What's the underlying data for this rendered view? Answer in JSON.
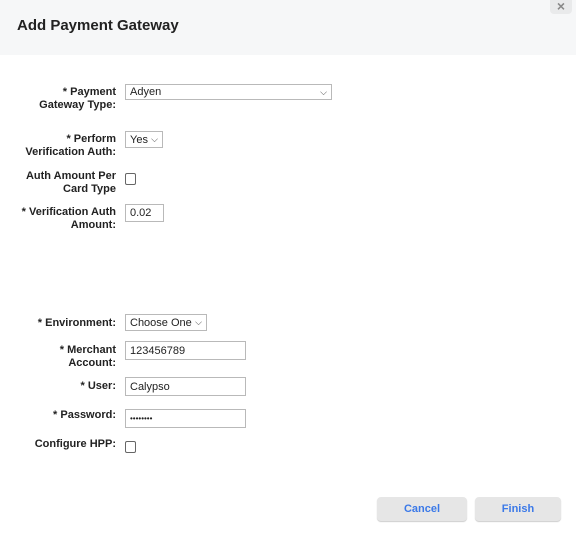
{
  "dialog": {
    "title": "Add Payment Gateway",
    "close_icon": "×"
  },
  "fields": {
    "gateway_type": {
      "label1": "* Payment",
      "label2": "Gateway Type:",
      "value": "Adyen"
    },
    "perform_verification": {
      "label1": "* Perform",
      "label2": "Verification Auth:",
      "value": "Yes"
    },
    "auth_per_card": {
      "label1": "Auth Amount Per",
      "label2": "Card Type",
      "checked": false
    },
    "verification_amount": {
      "label1": "* Verification Auth",
      "label2": "Amount:",
      "value": "0.02"
    },
    "environment": {
      "label": "* Environment:",
      "value": "Choose One"
    },
    "merchant_account": {
      "label1": "* Merchant",
      "label2": "Account:",
      "value": "123456789"
    },
    "user": {
      "label": "* User:",
      "value": "Calypso"
    },
    "password": {
      "label": "* Password:",
      "value": "••••••••"
    },
    "configure_hpp": {
      "label": "Configure HPP:",
      "checked": false
    }
  },
  "buttons": {
    "cancel": "Cancel",
    "finish": "Finish"
  },
  "chevron": "⌵"
}
